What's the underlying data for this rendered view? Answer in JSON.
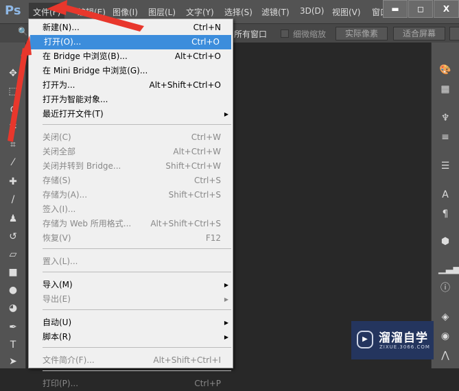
{
  "app": {
    "logo": "Ps"
  },
  "menubar": [
    "文件(F)",
    "编辑(E)",
    "图像(I)",
    "图层(L)",
    "文字(Y)",
    "选择(S)",
    "滤镜(T)",
    "3D(D)",
    "视图(V)",
    "窗口("
  ],
  "window_controls": {
    "minimize": "▬",
    "maximize": "◻",
    "close": "X"
  },
  "options_bar": {
    "partial_label": "所有窗口",
    "checkbox_label": "细微缩放",
    "btn_actual": "实际像素",
    "btn_fit": "适合屏幕"
  },
  "file_menu": [
    {
      "label": "新建(N)...",
      "shortcut": "Ctrl+N"
    },
    {
      "label": "打开(O)...",
      "shortcut": "Ctrl+O",
      "highlighted": true
    },
    {
      "label": "在 Bridge 中浏览(B)...",
      "shortcut": "Alt+Ctrl+O"
    },
    {
      "label": "在 Mini Bridge 中浏览(G)...",
      "shortcut": ""
    },
    {
      "label": "打开为...",
      "shortcut": "Alt+Shift+Ctrl+O"
    },
    {
      "label": "打开为智能对象...",
      "shortcut": ""
    },
    {
      "label": "最近打开文件(T)",
      "shortcut": "",
      "submenu": true
    },
    {
      "sep": true
    },
    {
      "label": "关闭(C)",
      "shortcut": "Ctrl+W",
      "disabled": true
    },
    {
      "label": "关闭全部",
      "shortcut": "Alt+Ctrl+W",
      "disabled": true
    },
    {
      "label": "关闭并转到 Bridge...",
      "shortcut": "Shift+Ctrl+W",
      "disabled": true
    },
    {
      "label": "存储(S)",
      "shortcut": "Ctrl+S",
      "disabled": true
    },
    {
      "label": "存储为(A)...",
      "shortcut": "Shift+Ctrl+S",
      "disabled": true
    },
    {
      "label": "签入(I)...",
      "shortcut": "",
      "disabled": true
    },
    {
      "label": "存储为 Web 所用格式...",
      "shortcut": "Alt+Shift+Ctrl+S",
      "disabled": true
    },
    {
      "label": "恢复(V)",
      "shortcut": "F12",
      "disabled": true
    },
    {
      "sep": true
    },
    {
      "label": "置入(L)...",
      "shortcut": "",
      "disabled": true
    },
    {
      "sep": true
    },
    {
      "label": "导入(M)",
      "shortcut": "",
      "submenu": true
    },
    {
      "label": "导出(E)",
      "shortcut": "",
      "submenu": true,
      "disabled": true
    },
    {
      "sep": true
    },
    {
      "label": "自动(U)",
      "shortcut": "",
      "submenu": true
    },
    {
      "label": "脚本(R)",
      "shortcut": "",
      "submenu": true
    },
    {
      "sep": true
    },
    {
      "label": "文件简介(F)...",
      "shortcut": "Alt+Shift+Ctrl+I",
      "disabled": true
    },
    {
      "sep": true
    },
    {
      "label": "打印(P)...",
      "shortcut": "Ctrl+P",
      "disabled": true
    }
  ],
  "watermark": {
    "title": "溜溜自学",
    "url": "ZIXUE.3066.COM"
  },
  "colors": {
    "highlight": "#3c8ddc",
    "arrow": "#e8372c",
    "watermark_bg": "#24355e"
  }
}
